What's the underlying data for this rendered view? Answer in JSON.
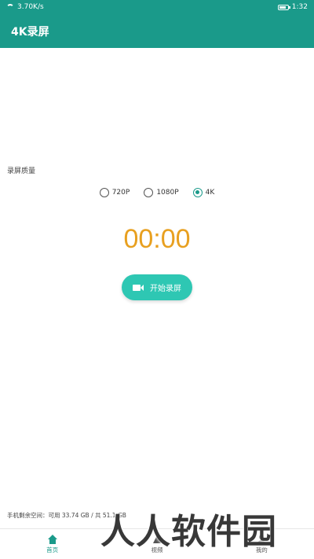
{
  "status_bar": {
    "network_speed": "3.70K/s",
    "time": "1:32"
  },
  "app_bar": {
    "title": "4K录屏"
  },
  "quality": {
    "label": "录屏质量",
    "options": [
      "720P",
      "1080P",
      "4K"
    ],
    "selected": "4K"
  },
  "timer": {
    "value": "00:00",
    "color": "#e8a020"
  },
  "record_button": {
    "label": "开始录屏"
  },
  "storage": {
    "text": "手机剩余空间：可用 33.74 GB / 共 51.1  GB"
  },
  "bottom_nav": {
    "items": [
      {
        "label": "首页",
        "icon": "home-icon",
        "active": true
      },
      {
        "label": "视频",
        "icon": "video-icon",
        "active": false
      },
      {
        "label": "我的",
        "icon": "user-icon",
        "active": false
      }
    ]
  },
  "watermark": {
    "text": "人人软件园"
  },
  "colors": {
    "primary": "#1a9a8a",
    "button": "#2ec7b3"
  }
}
